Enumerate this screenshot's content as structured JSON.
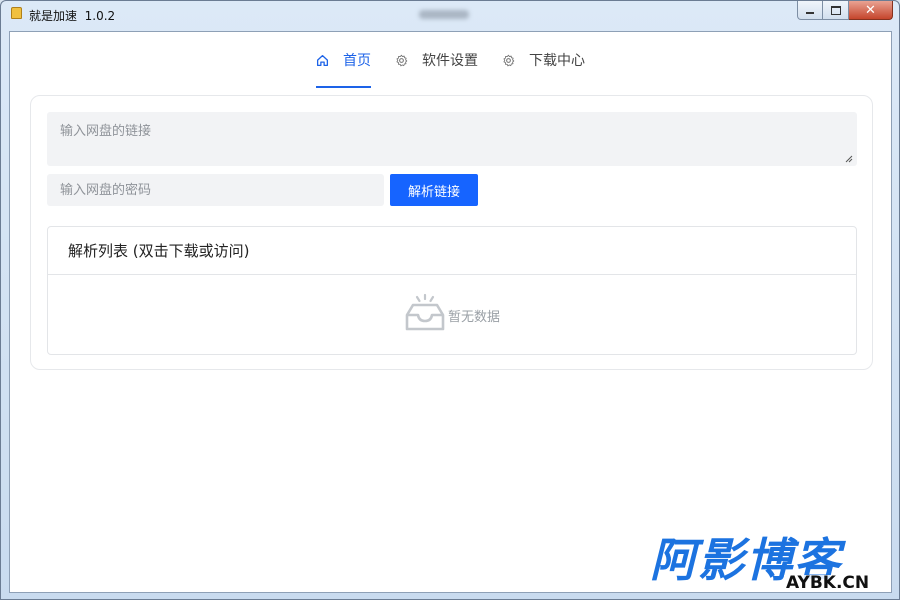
{
  "window": {
    "title": "就是加速  1.0.2",
    "controls": {
      "minimize_icon": "minimize-icon",
      "maximize_icon": "maximize-icon",
      "close_icon": "close-icon"
    }
  },
  "tabs": [
    {
      "label": "首页",
      "icon": "home-icon",
      "active": true
    },
    {
      "label": "软件设置",
      "icon": "gear-icon",
      "active": false
    },
    {
      "label": "下载中心",
      "icon": "gear-icon",
      "active": false
    }
  ],
  "form": {
    "link_placeholder": "输入网盘的链接",
    "link_value": "",
    "password_placeholder": "输入网盘的密码",
    "password_value": "",
    "parse_button_label": "解析链接"
  },
  "list": {
    "title": "解析列表 (双击下载或访问)",
    "empty_text": "暂无数据",
    "empty_icon": "empty-inbox-icon",
    "items": []
  },
  "watermark": {
    "main": "阿影博客",
    "sub": "AYBK.CN"
  },
  "colors": {
    "accent": "#1664ff",
    "tab_active": "#1d63e8",
    "input_bg": "#f2f3f5",
    "watermark_blue": "#1c73e0"
  }
}
